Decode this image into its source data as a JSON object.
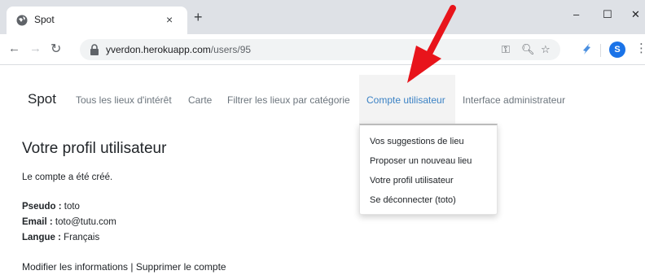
{
  "browser": {
    "tab_title": "Spot",
    "tab_close": "×",
    "new_tab": "+",
    "minimize": "–",
    "maximize": "☐",
    "close": "✕",
    "url_host": "yverdon.herokuapp.com",
    "url_path": "/users/95",
    "profile_initial": "S"
  },
  "navbar": {
    "brand": "Spot",
    "links": [
      "Tous les lieux d'intérêt",
      "Carte",
      "Filtrer les lieux par catégorie",
      "Compte utilisateur",
      "Interface administrateur"
    ]
  },
  "dropdown": {
    "items": [
      "Vos suggestions de lieu",
      "Proposer un nouveau lieu",
      "Votre profil utilisateur",
      "Se déconnecter (toto)"
    ]
  },
  "profile": {
    "title": "Votre profil utilisateur",
    "message": "Le compte a été créé.",
    "pseudo_label": "Pseudo :",
    "pseudo_value": "toto",
    "email_label": "Email :",
    "email_value": "toto@tutu.com",
    "langue_label": "Langue :",
    "langue_value": "Français",
    "edit_link": "Modifier les informations",
    "separator": "|",
    "delete_link": "Supprimer le compte"
  },
  "colors": {
    "active_link": "#3b82c4",
    "annotation_arrow": "#e8141b"
  }
}
